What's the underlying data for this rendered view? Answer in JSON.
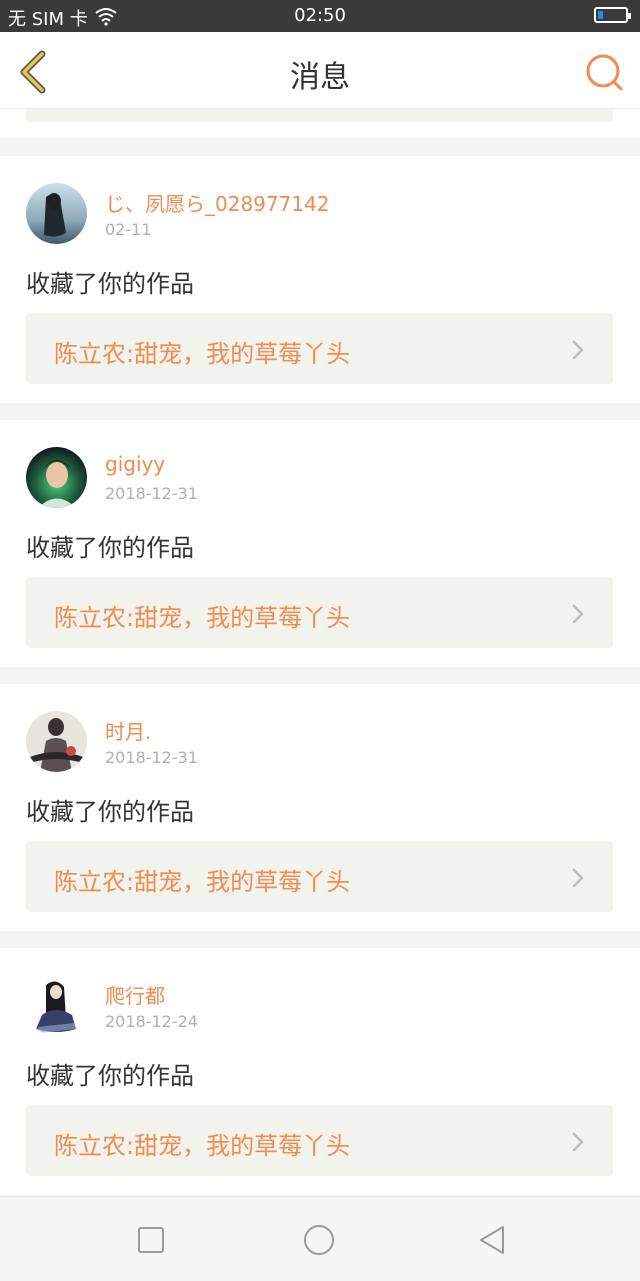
{
  "status_bar": {
    "carrier": "无 SIM 卡",
    "time": "02:50",
    "wifi_icon": "wifi-icon",
    "battery_icon": "battery-icon"
  },
  "header": {
    "title": "消息",
    "back_icon": "back-chevron-icon",
    "search_icon": "search-icon"
  },
  "notifications": [
    {
      "username": "じ、夙愿ら_028977142",
      "date": "02-11",
      "action": "收藏了你的作品",
      "work_title": "陈立农:甜宠，我的草莓丫头"
    },
    {
      "username": "gigiyy",
      "date": "2018-12-31",
      "action": "收藏了你的作品",
      "work_title": "陈立农:甜宠，我的草莓丫头"
    },
    {
      "username": "时月.",
      "date": "2018-12-31",
      "action": "收藏了你的作品",
      "work_title": "陈立农:甜宠，我的草莓丫头"
    },
    {
      "username": "爬行都",
      "date": "2018-12-24",
      "action": "收藏了你的作品",
      "work_title": "陈立农:甜宠，我的草莓丫头"
    }
  ],
  "nav_bar": {
    "recents_icon": "square-icon",
    "home_icon": "circle-icon",
    "back_icon": "triangle-back-icon"
  },
  "colors": {
    "accent": "#f08c50",
    "back_chevron": "#f0c24a"
  }
}
